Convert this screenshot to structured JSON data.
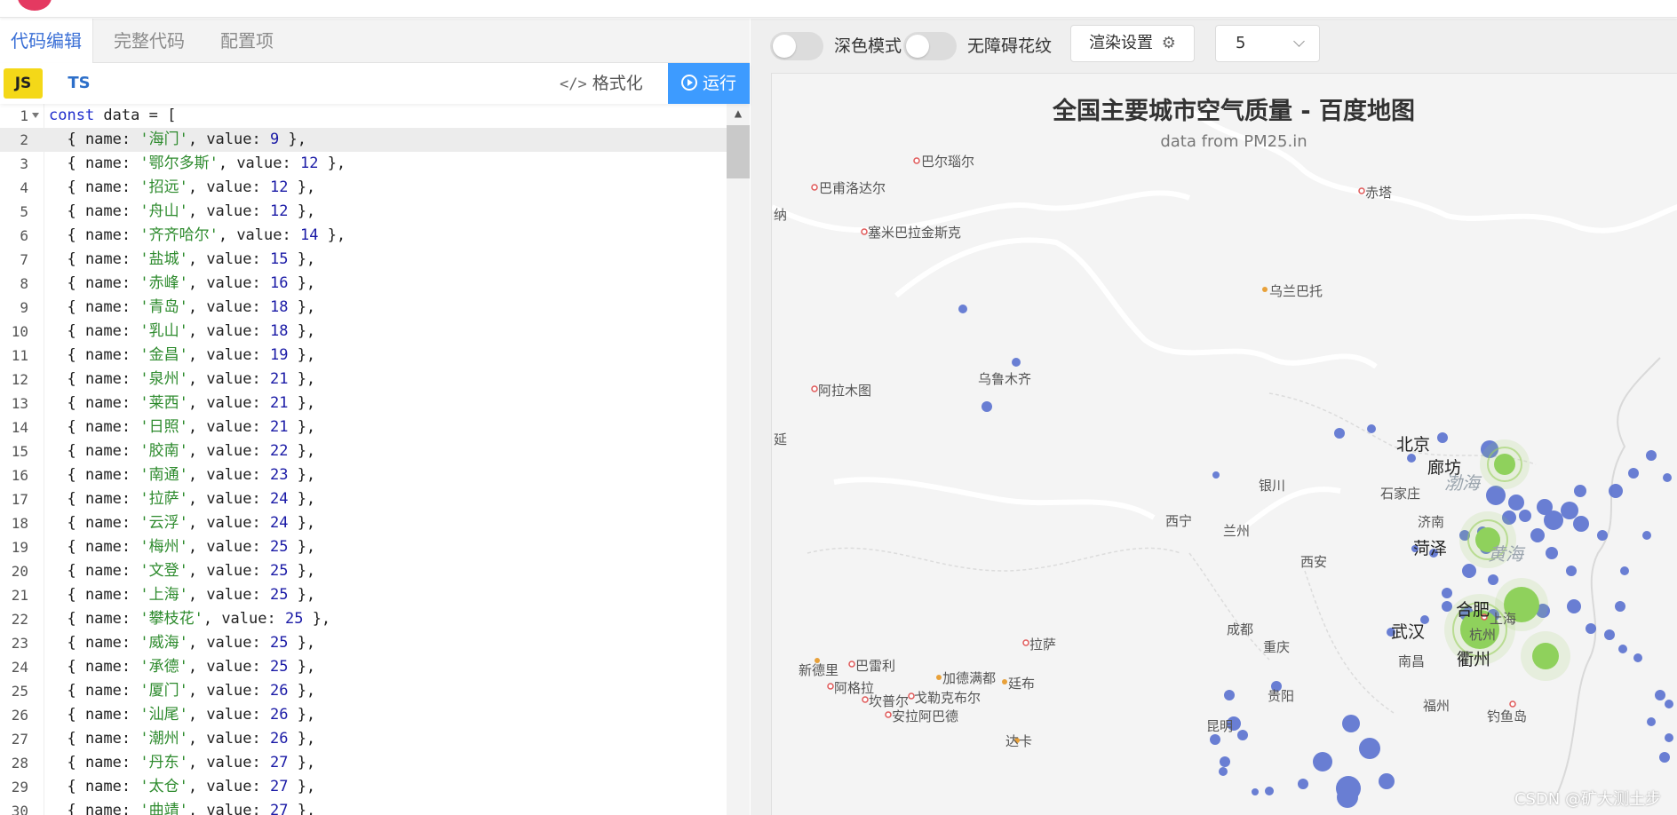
{
  "tabs": [
    {
      "label": "代码编辑"
    },
    {
      "label": "完整代码"
    },
    {
      "label": "配置项"
    }
  ],
  "toolbar": {
    "js_label": "JS",
    "ts_label": "TS",
    "format_label": "格式化",
    "run_label": "运行"
  },
  "code_lines": [
    {
      "n": "1",
      "prefix": "",
      "name": "",
      "value": "",
      "raw": "const data = ["
    },
    {
      "n": "2",
      "name": "海门",
      "value": "9"
    },
    {
      "n": "3",
      "name": "鄂尔多斯",
      "value": "12"
    },
    {
      "n": "4",
      "name": "招远",
      "value": "12"
    },
    {
      "n": "5",
      "name": "舟山",
      "value": "12"
    },
    {
      "n": "6",
      "name": "齐齐哈尔",
      "value": "14"
    },
    {
      "n": "7",
      "name": "盐城",
      "value": "15"
    },
    {
      "n": "8",
      "name": "赤峰",
      "value": "16"
    },
    {
      "n": "9",
      "name": "青岛",
      "value": "18"
    },
    {
      "n": "10",
      "name": "乳山",
      "value": "18"
    },
    {
      "n": "11",
      "name": "金昌",
      "value": "19"
    },
    {
      "n": "12",
      "name": "泉州",
      "value": "21"
    },
    {
      "n": "13",
      "name": "莱西",
      "value": "21"
    },
    {
      "n": "14",
      "name": "日照",
      "value": "21"
    },
    {
      "n": "15",
      "name": "胶南",
      "value": "22"
    },
    {
      "n": "16",
      "name": "南通",
      "value": "23"
    },
    {
      "n": "17",
      "name": "拉萨",
      "value": "24"
    },
    {
      "n": "18",
      "name": "云浮",
      "value": "24"
    },
    {
      "n": "19",
      "name": "梅州",
      "value": "25"
    },
    {
      "n": "20",
      "name": "文登",
      "value": "25"
    },
    {
      "n": "21",
      "name": "上海",
      "value": "25"
    },
    {
      "n": "22",
      "name": "攀枝花",
      "value": "25"
    },
    {
      "n": "23",
      "name": "威海",
      "value": "25"
    },
    {
      "n": "24",
      "name": "承德",
      "value": "25"
    },
    {
      "n": "25",
      "name": "厦门",
      "value": "26"
    },
    {
      "n": "26",
      "name": "汕尾",
      "value": "26"
    },
    {
      "n": "27",
      "name": "潮州",
      "value": "26"
    },
    {
      "n": "28",
      "name": "丹东",
      "value": "27"
    },
    {
      "n": "29",
      "name": "太仓",
      "value": "27"
    },
    {
      "n": "30",
      "name": "曲靖",
      "value": "27"
    }
  ],
  "controls": {
    "dark_mode_label": "深色模式",
    "a11y_label": "无障碍花纹",
    "render_settings_label": "渲染设置",
    "select_value": "5"
  },
  "map": {
    "title": "全国主要城市空气质量 - 百度地图",
    "subtitle": "data from PM25.in",
    "cities": [
      "巴尔瑙尔",
      "巴甫洛达尔",
      "塞米巴拉金斯克",
      "乌兰巴托",
      "赤塔",
      "阿拉木图",
      "乌鲁木齐",
      "北京",
      "廊坊",
      "石家庄",
      "银川",
      "西宁",
      "兰州",
      "西安",
      "济南",
      "菏泽",
      "合肥",
      "武汉",
      "上海",
      "杭州",
      "成都",
      "重庆",
      "南昌",
      "衢州",
      "拉萨",
      "新德里",
      "巴雷利",
      "加德满都",
      "阿格拉",
      "坎普尔",
      "戈勒克布尔",
      "安拉阿巴德",
      "廷布",
      "贵阳",
      "昆明",
      "福州",
      "钓鱼岛",
      "达卡",
      "纳",
      "延",
      "渤海",
      "黄海"
    ],
    "watermark": "CSDN @矿大测土步"
  }
}
